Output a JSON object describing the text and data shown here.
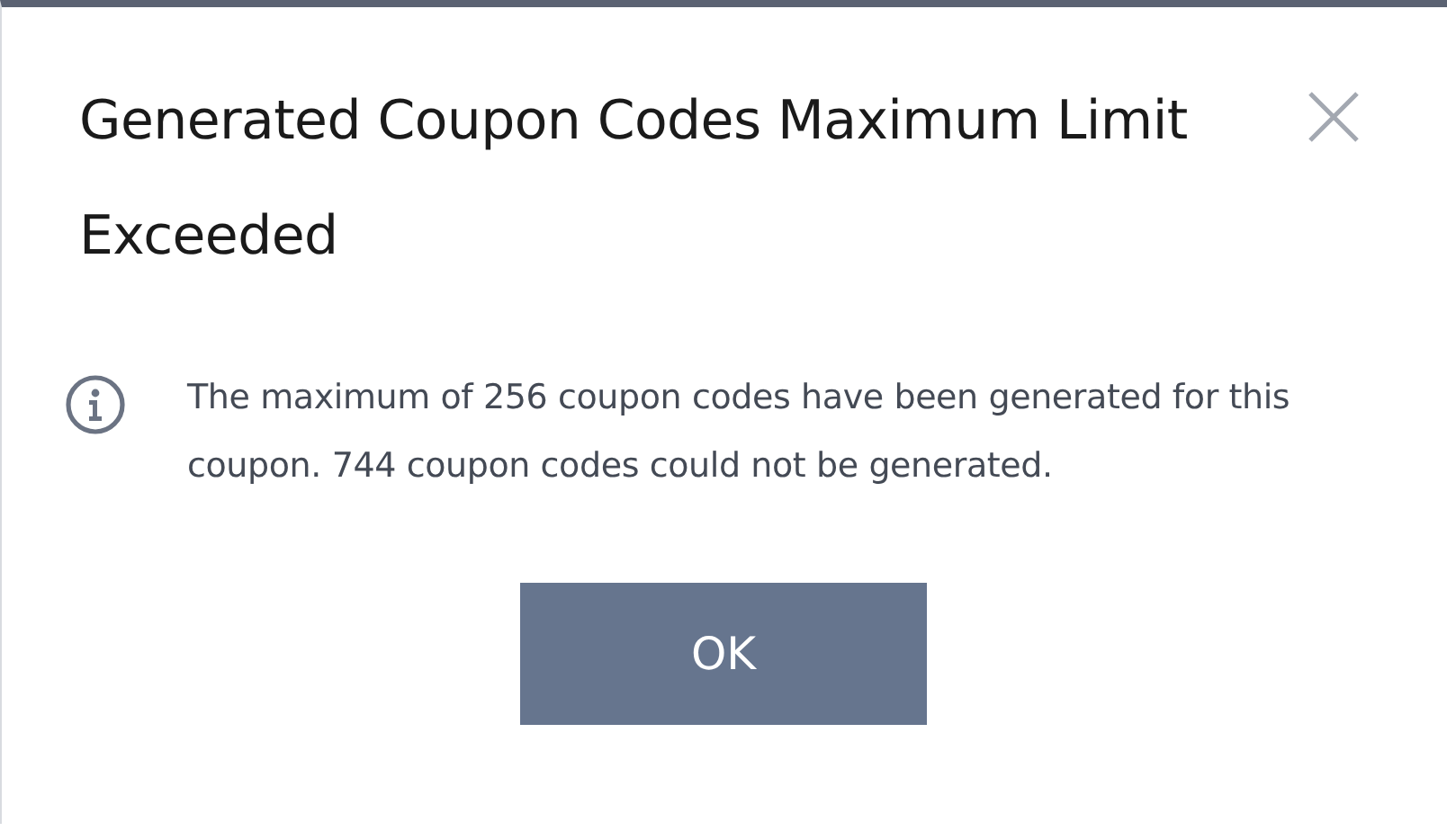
{
  "dialog": {
    "title": "Generated Coupon Codes Maximum Limit Exceeded",
    "message": "The maximum of 256 coupon codes have been generated for this coupon. 744 coupon codes could not be generated.",
    "buttons": [
      "OK"
    ]
  }
}
